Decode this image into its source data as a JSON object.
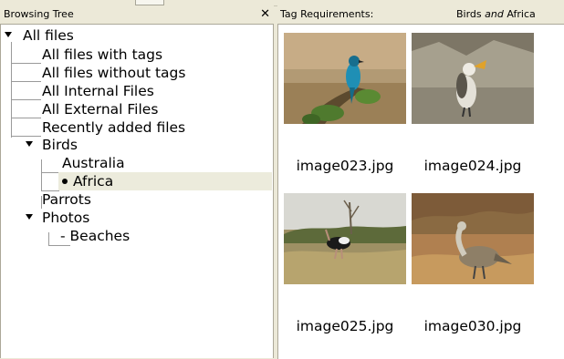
{
  "left_panel": {
    "title": "Browsing Tree",
    "close_glyph": "✕"
  },
  "tree": {
    "all_files": "All files",
    "with_tags": "All files with tags",
    "without_tags": "All files without tags",
    "internal": "All Internal Files",
    "external": "All External Files",
    "recent": "Recently added files",
    "birds": "Birds",
    "australia": "Australia",
    "africa": "Africa",
    "parrots": "Parrots",
    "photos": "Photos",
    "beaches": "- Beaches"
  },
  "right_panel": {
    "label": "Tag Requirements:",
    "query_a": "Birds",
    "query_op": "and",
    "query_b": "Africa"
  },
  "images": [
    {
      "name": "image023.jpg"
    },
    {
      "name": "image024.jpg"
    },
    {
      "name": "image025.jpg"
    },
    {
      "name": "image030.jpg"
    }
  ],
  "colors": {
    "chrome": "#ece9d8",
    "selection": "#ecebdc",
    "tree_lines": "#9a9a9a"
  }
}
